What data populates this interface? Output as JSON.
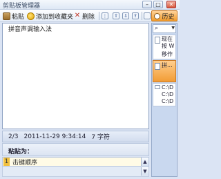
{
  "window": {
    "title": "剪贴板管理器",
    "min": "–",
    "max": "□",
    "close": "✕"
  },
  "toolbar": {
    "paste": "粘贴",
    "add_fav": "添加到收藏夹",
    "delete": "删除",
    "icon_a": "⋮",
    "icon_b": "⇧",
    "icon_c": "⇩",
    "icon_d": "⇪",
    "history": "历史"
  },
  "content": {
    "text": "拼音声调输入法"
  },
  "status": {
    "position": "2/3",
    "datetime": "2011-11-29 9:34:14",
    "chars": "7 字符"
  },
  "paste_as": {
    "label": "粘贴为：",
    "items": [
      {
        "num": "1",
        "text": "击键顺序"
      }
    ]
  },
  "history": {
    "items": [
      {
        "line1": "现在",
        "line2": "按 W",
        "line3": "移作"
      },
      {
        "line1": "拼...",
        "line2": ""
      },
      {
        "line1": "C:\\D",
        "line2": "C:\\D",
        "line3": "C:\\D"
      }
    ]
  },
  "colors": {
    "accent": "#f39c2c",
    "frame": "#dbe4f4"
  }
}
